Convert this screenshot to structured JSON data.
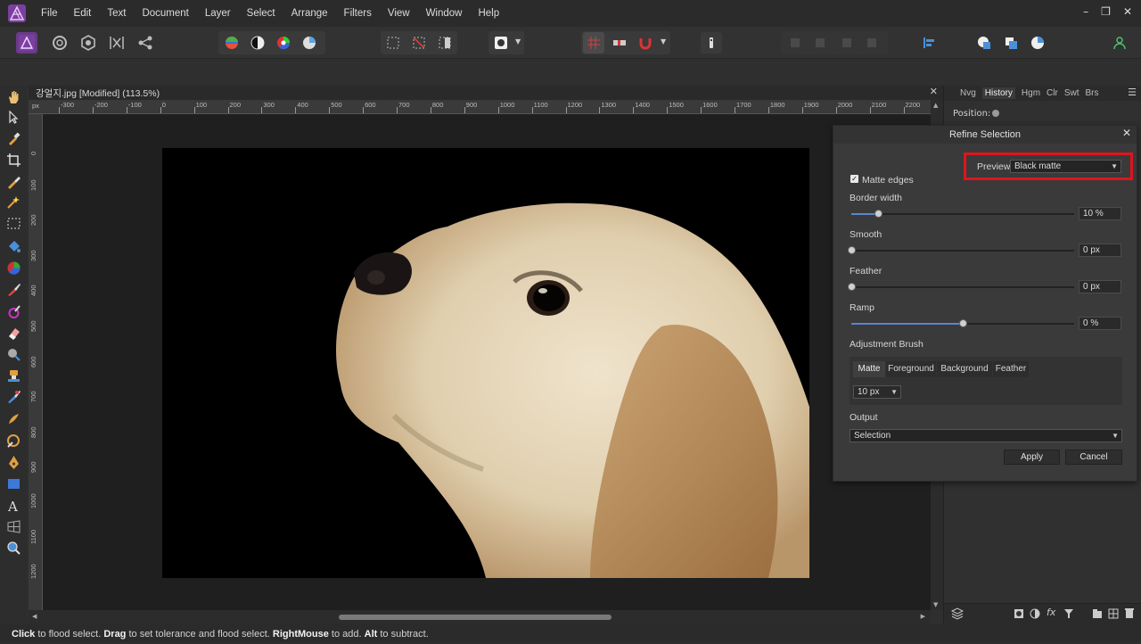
{
  "menu": [
    "File",
    "Edit",
    "Text",
    "Document",
    "Layer",
    "Select",
    "Arrange",
    "Filters",
    "View",
    "Window",
    "Help"
  ],
  "document": {
    "title": "강얼지.jpg [Modified] (113.5%)"
  },
  "ruler": {
    "unit": "px",
    "h_labels": [
      "-300",
      "-200",
      "-100",
      "0",
      "100",
      "200",
      "300",
      "400",
      "500",
      "600",
      "700",
      "800",
      "900",
      "1000",
      "1100",
      "1200",
      "1300",
      "1400",
      "1500",
      "1600",
      "1700",
      "1800",
      "1900",
      "2000",
      "2100",
      "2200"
    ],
    "v_labels": [
      "0",
      "100",
      "200",
      "300",
      "400",
      "500",
      "600",
      "700",
      "800",
      "900",
      "1000",
      "1100",
      "1200"
    ]
  },
  "right_panel": {
    "tabs": [
      "Nvg",
      "History",
      "Hgm",
      "Clr",
      "Swt",
      "Brs"
    ],
    "active_tab": "History",
    "position_label": "Position:"
  },
  "dialog": {
    "title": "Refine Selection",
    "preview_label": "Preview",
    "preview_value": "Black matte",
    "matte_edges": {
      "label": "Matte edges",
      "checked": true
    },
    "border_width": {
      "label": "Border width",
      "value": "10 %",
      "level": 0.12
    },
    "smooth": {
      "label": "Smooth",
      "value": "0 px",
      "level": 0
    },
    "feather": {
      "label": "Feather",
      "value": "0 px",
      "level": 0
    },
    "ramp": {
      "label": "Ramp",
      "value": "0 %",
      "level": 0.5
    },
    "adjustment_brush": {
      "label": "Adjustment Brush",
      "modes": [
        "Matte",
        "Foreground",
        "Background",
        "Feather"
      ],
      "active_mode": "Matte",
      "size": "10 px"
    },
    "output": {
      "label": "Output",
      "value": "Selection"
    },
    "apply_label": "Apply",
    "cancel_label": "Cancel"
  },
  "status": {
    "click": "Click",
    "click_text": " to flood select. ",
    "drag": "Drag",
    "drag_text": " to set tolerance and flood select. ",
    "right": "RightMouse",
    "right_text": " to add. ",
    "alt": "Alt",
    "alt_text": " to subtract."
  },
  "colors": {
    "accent": "#5a86c8",
    "highlight": "#e0141e",
    "brand": "#7b3fa0"
  }
}
